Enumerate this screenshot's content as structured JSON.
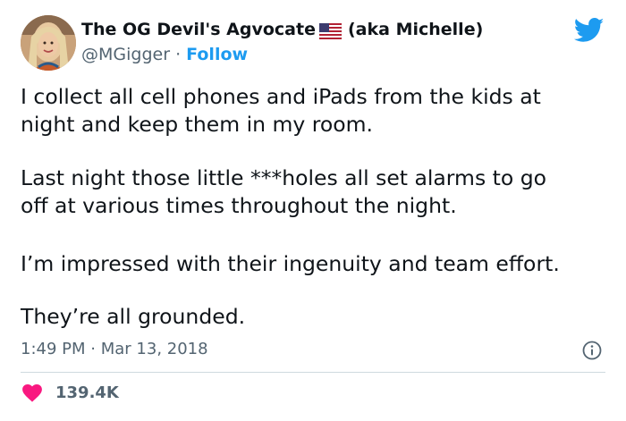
{
  "author": {
    "display_name": "The OG Devil's Agvocate",
    "flag_icon": "us-flag-icon",
    "aka": "(aka Michelle)",
    "handle": "@MGigger",
    "separator": "·",
    "follow_label": "Follow"
  },
  "tweet": {
    "paragraphs": [
      {
        "lines": [
          "I collect all cell phones and iPads from the kids at",
          "night and keep them in my room."
        ]
      },
      {
        "lines": [
          "Last night those little ***holes all set alarms to go",
          "off at various times throughout the night."
        ]
      },
      {
        "lines": [
          "I’m impressed with their ingenuity and team effort."
        ]
      },
      {
        "lines": [
          "They’re all grounded."
        ]
      }
    ],
    "time": "1:49 PM",
    "date_separator": "·",
    "date": "Mar 13, 2018"
  },
  "engagement": {
    "likes": "139.4K"
  },
  "icons": {
    "brand": "twitter-bird-icon",
    "info": "info-icon",
    "like": "heart-icon"
  },
  "colors": {
    "brand_blue": "#1d9bf0",
    "text": "#0f1419",
    "secondary": "#536471",
    "heart": "#f91880",
    "divider": "#cfd9de"
  }
}
